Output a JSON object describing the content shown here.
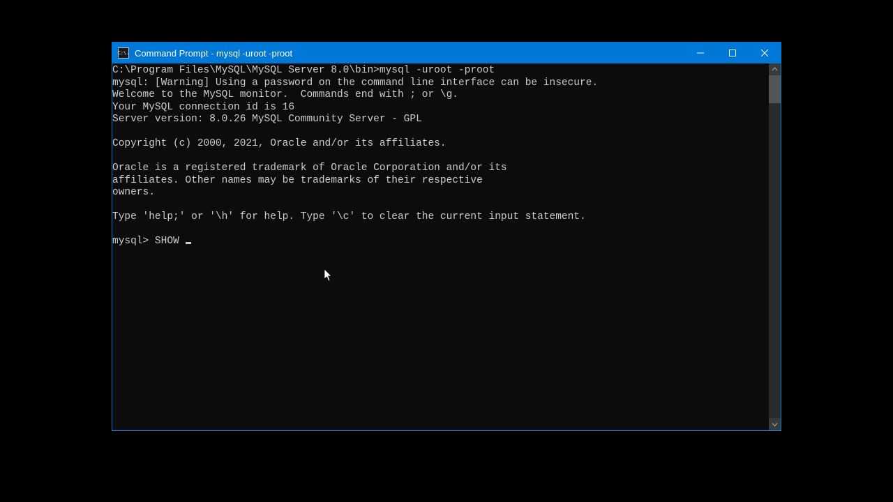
{
  "window": {
    "title": "Command Prompt - mysql  -uroot -proot"
  },
  "terminal": {
    "lines": [
      "C:\\Program Files\\MySQL\\MySQL Server 8.0\\bin>mysql -uroot -proot",
      "mysql: [Warning] Using a password on the command line interface can be insecure.",
      "Welcome to the MySQL monitor.  Commands end with ; or \\g.",
      "Your MySQL connection id is 16",
      "Server version: 8.0.26 MySQL Community Server - GPL",
      "",
      "Copyright (c) 2000, 2021, Oracle and/or its affiliates.",
      "",
      "Oracle is a registered trademark of Oracle Corporation and/or its",
      "affiliates. Other names may be trademarks of their respective",
      "owners.",
      "",
      "Type 'help;' or '\\h' for help. Type '\\c' to clear the current input statement.",
      ""
    ],
    "prompt": "mysql> ",
    "current_input": "SHOW "
  },
  "icon_label": "C:\\."
}
